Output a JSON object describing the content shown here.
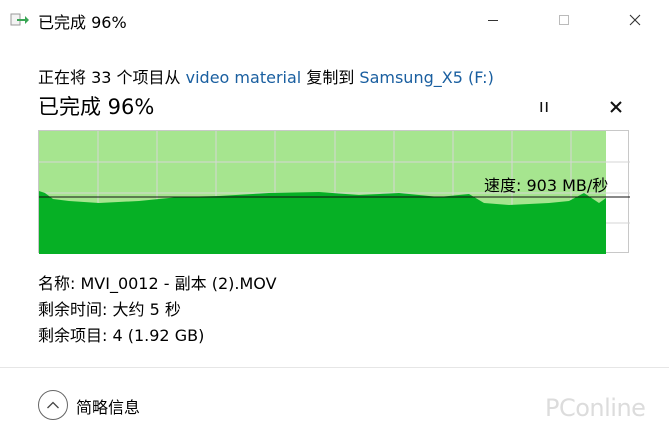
{
  "window": {
    "title": "已完成 96%",
    "icon": "copy-arrow-icon"
  },
  "copy": {
    "desc_prefix": "正在将 33 个项目从",
    "source": "video material",
    "desc_middle": "复制到",
    "destination": "Samsung_X5 (F:)",
    "status": "已完成 96%",
    "progress_percent": 96
  },
  "speed": {
    "label": "速度: 903 MB/秒",
    "current_mb_s": 903
  },
  "details": {
    "name": "名称:  MVI_0012 - 副本 (2).MOV",
    "time_remaining": "剩余时间:  大约 5 秒",
    "items_remaining": "剩余项目:  4 (1.92 GB)"
  },
  "footer": {
    "toggle_label": "简略信息"
  },
  "watermark": "PConline",
  "colors": {
    "progress_fill": "#a6e58f",
    "speed_fill": "#06b025",
    "link": "#1a5fa0"
  }
}
